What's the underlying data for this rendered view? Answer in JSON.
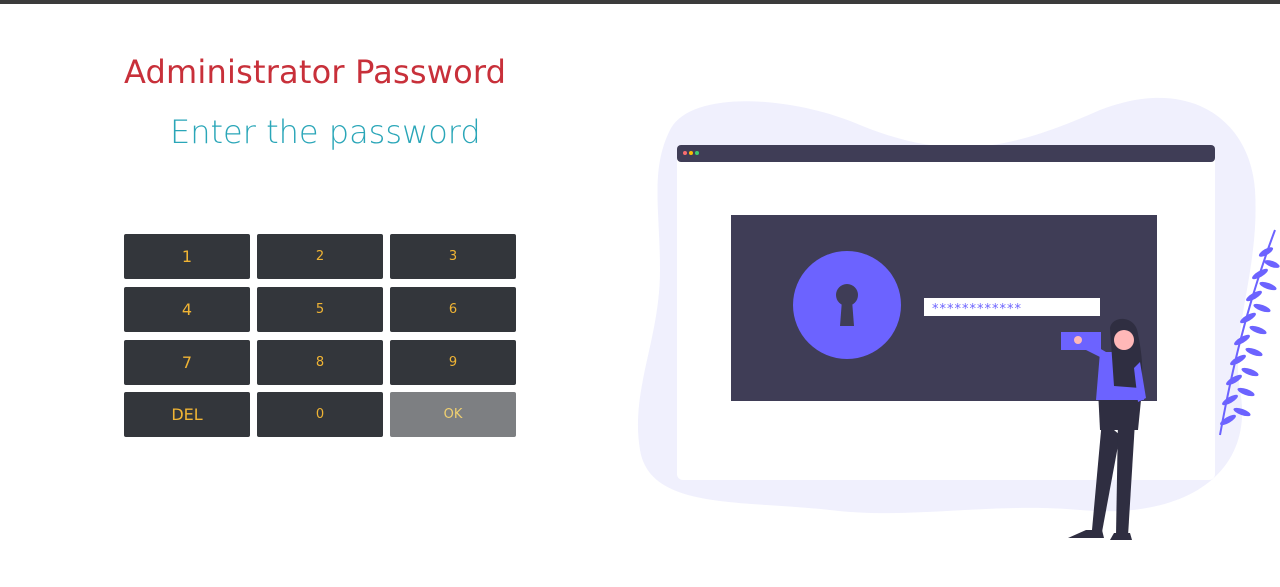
{
  "header": {
    "title": "Administrator Password",
    "subtitle": "Enter the password"
  },
  "keypad": {
    "keys": [
      {
        "label": "1"
      },
      {
        "label": "2"
      },
      {
        "label": "3"
      },
      {
        "label": "4"
      },
      {
        "label": "5"
      },
      {
        "label": "6"
      },
      {
        "label": "7"
      },
      {
        "label": "8"
      },
      {
        "label": "9"
      },
      {
        "label": "DEL"
      },
      {
        "label": "0"
      },
      {
        "label": "OK"
      }
    ]
  },
  "illustration": {
    "password_mask": "************",
    "colors": {
      "blob": "#f0f0fd",
      "dark_panel": "#3f3d56",
      "accent": "#6c63ff"
    }
  }
}
